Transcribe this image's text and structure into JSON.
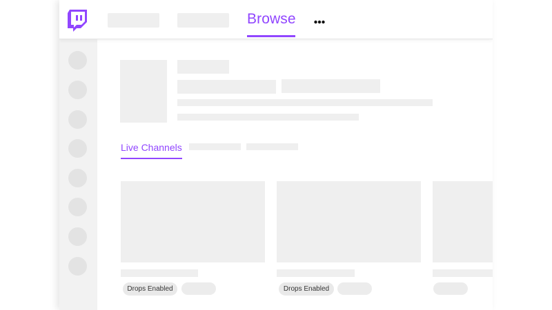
{
  "header": {
    "browse_label": "Browse",
    "more_icon": "more-horizontal-icon",
    "logo_icon": "twitch-glitch-icon"
  },
  "tabs": {
    "live_channels_label": "Live Channels"
  },
  "cards": [
    {
      "badge_label": "Drops Enabled"
    },
    {
      "badge_label": "Drops Enabled"
    },
    {
      "badge_label": ""
    }
  ],
  "colors": {
    "accent": "#9146ff",
    "skeleton": "#efefef",
    "sidebar": "#f2f2f2"
  }
}
